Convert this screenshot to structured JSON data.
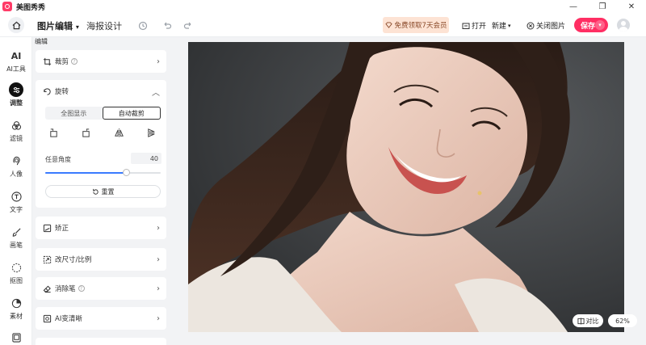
{
  "window": {
    "app_name": "美图秀秀",
    "minimize": "—",
    "restore": "❐",
    "close": "✕"
  },
  "toolbar": {
    "active_tab": "图片编辑",
    "active_tab_caret": "▾",
    "poster_tab": "海报设计",
    "vip_label": "免费领取7天会员",
    "open_label": "打开",
    "new_label": "新建",
    "new_caret": "▾",
    "close_image_label": "关闭图片",
    "save_label": "保存",
    "save_caret": "▾"
  },
  "rail": {
    "items": [
      {
        "label": "AI工具",
        "glyph": "AI"
      },
      {
        "label": "调整",
        "glyph": "⚙",
        "active": true
      },
      {
        "label": "滤镜",
        "glyph": "❋"
      },
      {
        "label": "人像",
        "glyph": "☺"
      },
      {
        "label": "文字",
        "glyph": "T"
      },
      {
        "label": "画笔",
        "glyph": "✎"
      },
      {
        "label": "抠图",
        "glyph": "◌"
      },
      {
        "label": "素材",
        "glyph": "◐"
      },
      {
        "label": "",
        "glyph": "▢"
      }
    ]
  },
  "panel": {
    "heading": "编辑",
    "crop_label": "裁剪",
    "rotate_label": "旋转",
    "rotate_collapse": "︿",
    "seg_full": "全图显示",
    "seg_auto": "自动裁剪",
    "angle_label": "任意角度",
    "angle_value": "40",
    "angle_fraction": 0.7,
    "reset_label": "重置",
    "straighten_label": "矫正",
    "resize_label": "改尺寸/比例",
    "eraser_label": "消除笔",
    "ai_sharpen_label": "AI变清晰",
    "chevron": "›",
    "help": "?"
  },
  "canvas": {
    "compare_label": "对比",
    "zoom_label": "62%"
  },
  "colors": {
    "accent": "#ff2e63",
    "slider": "#3a7bff",
    "vip_bg": "#fde3d4"
  }
}
